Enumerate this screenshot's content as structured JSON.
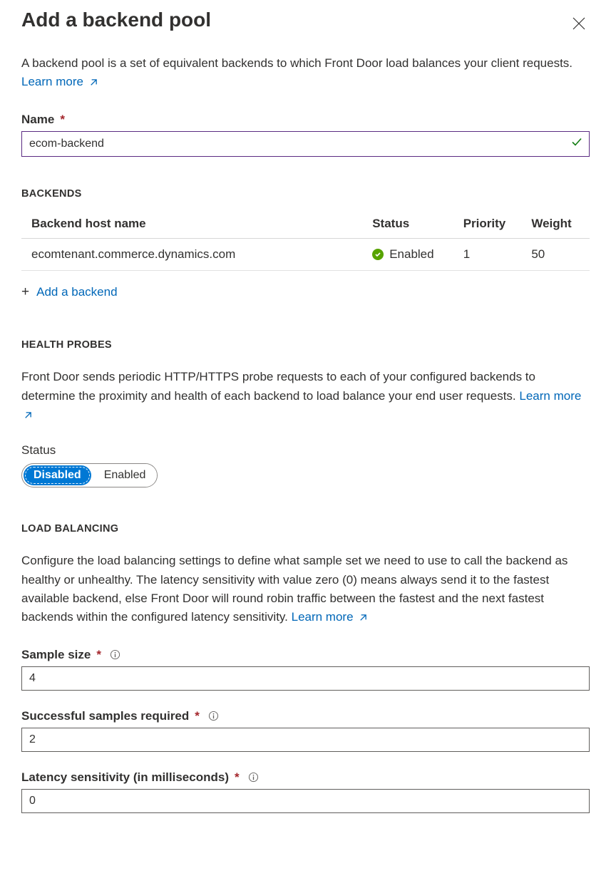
{
  "header": {
    "title": "Add a backend pool"
  },
  "intro": {
    "text": "A backend pool is a set of equivalent backends to which Front Door load balances your client requests. ",
    "learn_more": "Learn more"
  },
  "name_field": {
    "label": "Name",
    "value": "ecom-backend"
  },
  "backends": {
    "section_title": "BACKENDS",
    "columns": {
      "host": "Backend host name",
      "status": "Status",
      "priority": "Priority",
      "weight": "Weight"
    },
    "rows": [
      {
        "host": "ecomtenant.commerce.dynamics.com",
        "status": "Enabled",
        "priority": "1",
        "weight": "50"
      }
    ],
    "add_label": "Add a backend"
  },
  "health_probes": {
    "section_title": "HEALTH PROBES",
    "text": "Front Door sends periodic HTTP/HTTPS probe requests to each of your configured backends to determine the proximity and health of each backend to load balance your end user requests. ",
    "learn_more": "Learn more",
    "status_label": "Status",
    "toggle": {
      "disabled": "Disabled",
      "enabled": "Enabled",
      "active": "disabled"
    }
  },
  "load_balancing": {
    "section_title": "LOAD BALANCING",
    "text": "Configure the load balancing settings to define what sample set we need to use to call the backend as healthy or unhealthy. The latency sensitivity with value zero (0) means always send it to the fastest available backend, else Front Door will round robin traffic between the fastest and the next fastest backends within the configured latency sensitivity. ",
    "learn_more": "Learn more",
    "fields": {
      "sample_size": {
        "label": "Sample size",
        "value": "4"
      },
      "successful_samples": {
        "label": "Successful samples required",
        "value": "2"
      },
      "latency": {
        "label": "Latency sensitivity (in milliseconds)",
        "value": "0"
      }
    }
  }
}
